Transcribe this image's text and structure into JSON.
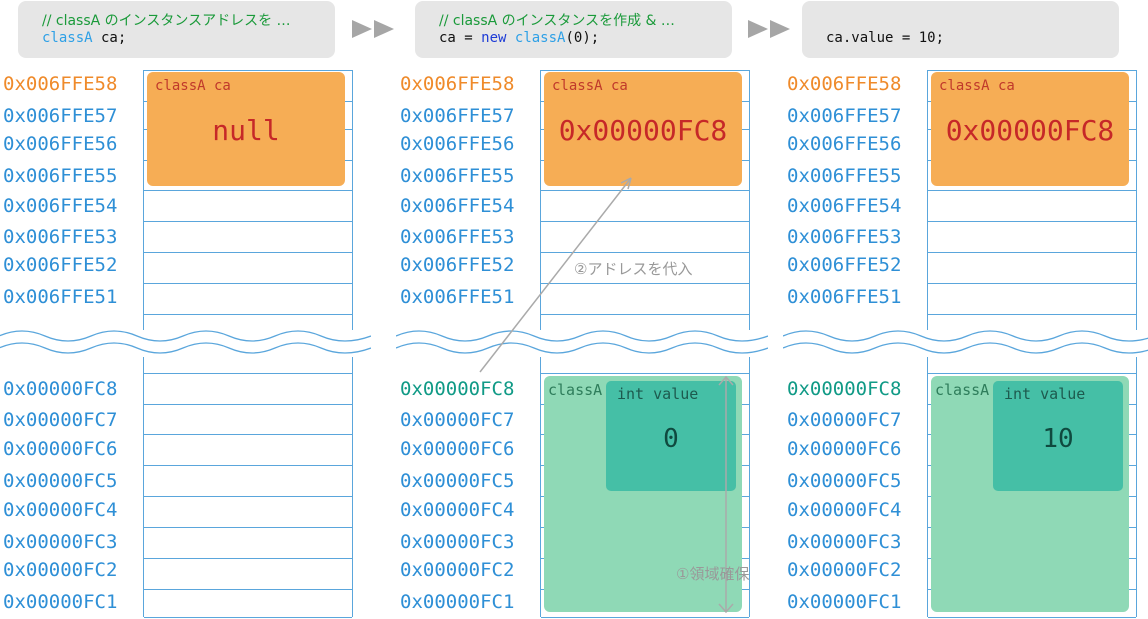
{
  "colors": {
    "stack_addr": "#2e8fd6",
    "highlight_stack": "#ef8a2a",
    "highlight_heap": "#109a86",
    "variable_box": "#f6ad55",
    "object_box": "#8fd9b6",
    "field_box": "#45bfa6",
    "comment": "#1a9a3a"
  },
  "stack_addresses": [
    "0x006FFE58",
    "0x006FFE57",
    "0x006FFE56",
    "0x006FFE55",
    "0x006FFE54",
    "0x006FFE53",
    "0x006FFE52",
    "0x006FFE51"
  ],
  "heap_addresses": [
    "0x00000FC8",
    "0x00000FC7",
    "0x00000FC6",
    "0x00000FC5",
    "0x00000FC4",
    "0x00000FC3",
    "0x00000FC2",
    "0x00000FC1"
  ],
  "steps": [
    {
      "comment": "// classA のインスタンスアドレスを …",
      "code": {
        "type": "classA",
        "rest": " ca;"
      },
      "var_name": "classA ca",
      "var_value": "null"
    },
    {
      "comment": "// classA のインスタンスを作成 & …",
      "code": {
        "pre": "ca = ",
        "kw": "new",
        "type": "classA",
        "rest": "(0);"
      },
      "var_name": "classA ca",
      "var_value": "0x00000FC8",
      "object_name": "classA",
      "field_name": "int value",
      "field_value": "0",
      "note_alloc": "①領域確保",
      "note_assign": "②アドレスを代入"
    },
    {
      "comment": "",
      "code": {
        "rest": "ca.value = 10;"
      },
      "var_name": "classA ca",
      "var_value": "0x00000FC8",
      "object_name": "classA",
      "field_name": "int value",
      "field_value": "10"
    }
  ]
}
